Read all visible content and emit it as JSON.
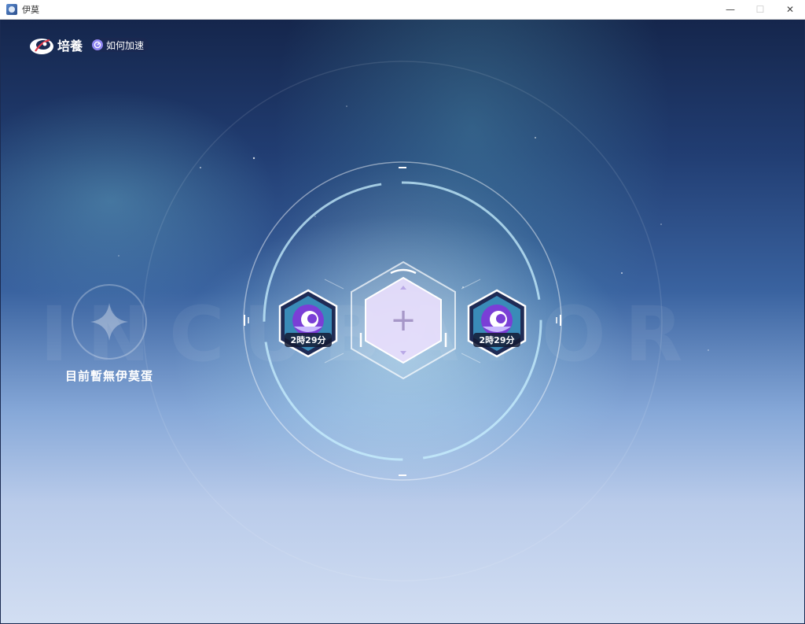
{
  "window": {
    "title": "伊莫",
    "minimize": "—",
    "maximize": "☐",
    "close": "✕"
  },
  "header": {
    "title": "培養",
    "boost_label": "如何加速"
  },
  "empty_slot": {
    "text": "目前暫無伊莫蛋"
  },
  "incubators": [
    {
      "timer": "2時29分"
    },
    {
      "timer": "2時29分"
    }
  ],
  "center_slot": {
    "symbol": "+"
  },
  "colors": {
    "accent": "#8f86f2",
    "egg_purple": "#7a3fd6"
  }
}
